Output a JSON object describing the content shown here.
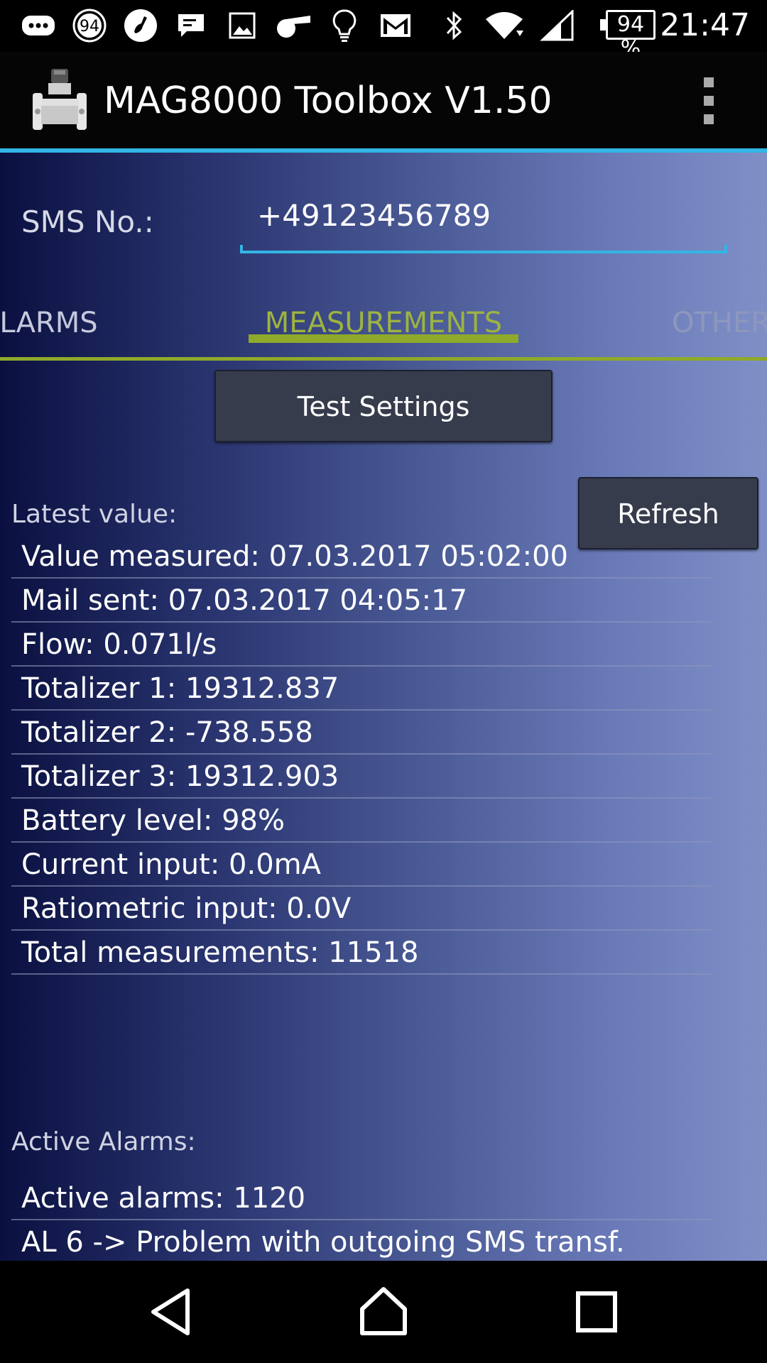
{
  "status_bar": {
    "icons": [
      "chat-icon",
      "notification-94-icon",
      "music-app-icon",
      "message-icon",
      "image-icon",
      "whistle-icon",
      "lightbulb-icon",
      "gmail-icon",
      "bluetooth-icon",
      "wifi-icon",
      "signal-icon"
    ],
    "notification_count": "94",
    "battery_percent": "94 %",
    "time": "21:47"
  },
  "app_bar": {
    "title": "MAG8000 Toolbox V1.50"
  },
  "sms": {
    "label": "SMS No.:",
    "value": "+49123456789"
  },
  "tabs": [
    {
      "label": "ALARMS",
      "state": "partial"
    },
    {
      "label": "MEASUREMENTS",
      "state": "active"
    },
    {
      "label": "OTHER",
      "state": "partial"
    }
  ],
  "buttons": {
    "test_settings": "Test Settings",
    "refresh": "Refresh"
  },
  "latest": {
    "label": "Latest value:",
    "rows": [
      "Value measured: 07.03.2017 05:02:00",
      "Mail sent: 07.03.2017 04:05:17",
      "Flow: 0.071l/s",
      "Totalizer 1: 19312.837",
      "Totalizer 2: -738.558",
      "Totalizer 3: 19312.903",
      "Battery level: 98%",
      "Current input: 0.0mA",
      "Ratiometric input: 0.0V",
      "Total measurements: 11518"
    ]
  },
  "alarms": {
    "label": "Active Alarms:",
    "rows": [
      "Active alarms: 1120",
      "AL 6 -> Problem with outgoing SMS transf."
    ]
  },
  "colors": {
    "accent_blue": "#33b5e5",
    "tab_active": "#9db341",
    "tab_indicator": "#8faa2a",
    "button_bg": "#363c4c"
  }
}
